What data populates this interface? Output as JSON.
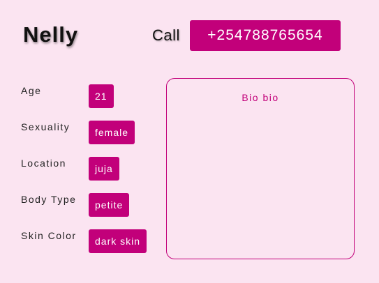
{
  "profile": {
    "name": "Nelly",
    "call_label": "Call",
    "phone": "+254788765654"
  },
  "attributes": [
    {
      "label": "Age",
      "value": "21"
    },
    {
      "label": "Sexuality",
      "value": "female"
    },
    {
      "label": "Location",
      "value": "juja"
    },
    {
      "label": "Body Type",
      "value": "petite"
    },
    {
      "label": "Skin Color",
      "value": "dark skin"
    }
  ],
  "bio": {
    "text": "Bio bio"
  },
  "colors": {
    "background": "#fbe4f1",
    "accent": "#c2007a",
    "text": "#111111"
  }
}
